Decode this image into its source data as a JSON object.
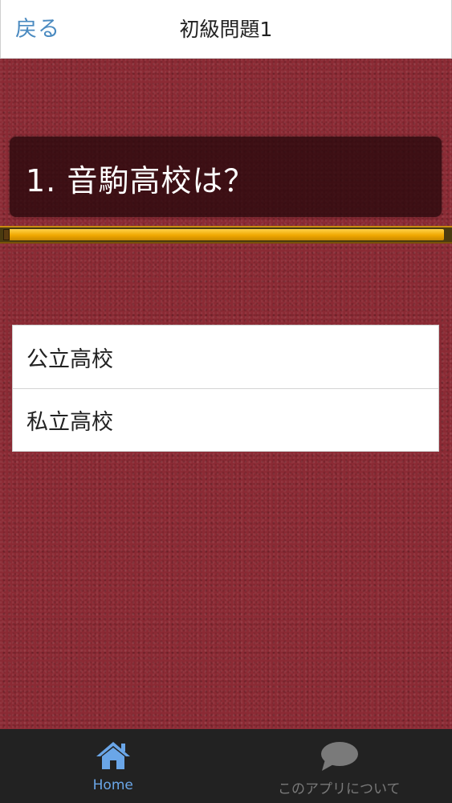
{
  "header": {
    "back_label": "戻る",
    "title": "初級問題1"
  },
  "question": {
    "text": "1. 音駒高校は？"
  },
  "progress": {
    "fraction": 0.99
  },
  "answers": [
    {
      "label": "公立高校"
    },
    {
      "label": "私立高校"
    }
  ],
  "bottom_nav": {
    "items": [
      {
        "label": "Home",
        "icon": "home-icon",
        "active": true
      },
      {
        "label": "このアプリについて",
        "icon": "speech-bubble-icon",
        "active": false
      }
    ]
  },
  "colors": {
    "accent": "#4a8ac0",
    "background": "#8b2a34",
    "progress": "#f0a800",
    "nav_active": "#6aa6e8"
  }
}
